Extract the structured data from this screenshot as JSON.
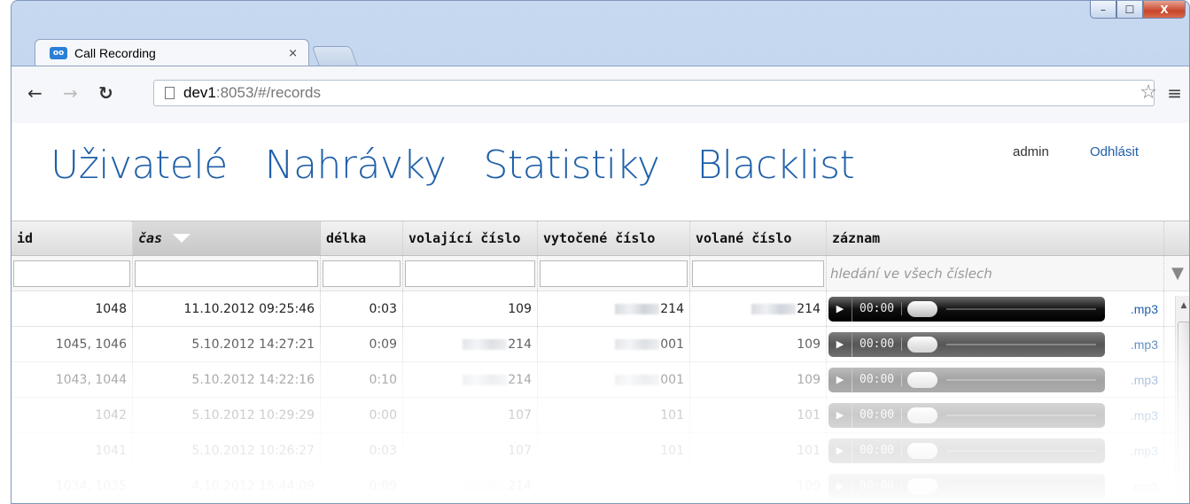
{
  "browser": {
    "tab_title": "Call Recording",
    "favicon": "oo",
    "tab_close": "×",
    "url_host": "dev1",
    "url_path": ":8053/#/records",
    "window_controls": {
      "minimize": "–",
      "maximize": "☐",
      "close": "X"
    }
  },
  "nav": {
    "items": [
      {
        "label": "Uživatelé"
      },
      {
        "label": "Nahrávky"
      },
      {
        "label": "Statistiky"
      },
      {
        "label": "Blacklist"
      }
    ],
    "user": "admin",
    "logout": "Odhlásit"
  },
  "table": {
    "columns": [
      "id",
      "čas",
      "délka",
      "volající číslo",
      "vytočené číslo",
      "volané číslo",
      "záznam"
    ],
    "sorted_column": "čas",
    "sort_direction": "desc",
    "search_placeholder": "hledání ve všech číslech",
    "rows": [
      {
        "id": "1048",
        "time": "11.10.2012 09:25:46",
        "length": "0:03",
        "caller": "109",
        "dialed": "214",
        "dialed_blur": true,
        "called": "214",
        "called_blur": true,
        "player_time": "00:00",
        "file": ".mp3"
      },
      {
        "id": "1045, 1046",
        "time": "5.10.2012 14:27:21",
        "length": "0:09",
        "caller": "214",
        "caller_blur": true,
        "dialed": "001",
        "dialed_blur": true,
        "called": "109",
        "player_time": "00:00",
        "file": ".mp3"
      },
      {
        "id": "1043, 1044",
        "time": "5.10.2012 14:22:16",
        "length": "0:10",
        "caller": "214",
        "caller_blur": true,
        "dialed": "001",
        "dialed_blur": true,
        "called": "109",
        "player_time": "00:00",
        "file": ".mp3"
      },
      {
        "id": "1042",
        "time": "5.10.2012 10:29:29",
        "length": "0:00",
        "caller": "107",
        "dialed": "101",
        "called": "101",
        "player_time": "00:00",
        "file": ".mp3"
      },
      {
        "id": "1041",
        "time": "5.10.2012 10:26:27",
        "length": "0:03",
        "caller": "107",
        "dialed": "101",
        "called": "101",
        "player_time": "00:00",
        "file": ".mp3"
      },
      {
        "id": "1034, 1035",
        "time": "4.10.2012 15:44:09",
        "length": "0:09",
        "caller": "214",
        "caller_blur": true,
        "dialed": "",
        "called": "109",
        "player_time": "00:00",
        "file": ".mp3"
      }
    ]
  },
  "icons": {
    "play": "play-icon",
    "filter_clear": "filter-clear-icon",
    "star": "star-icon",
    "menu": "menu-icon"
  }
}
